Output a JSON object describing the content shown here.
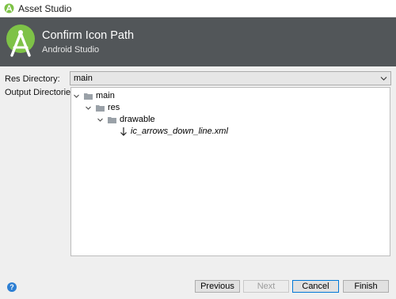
{
  "window": {
    "title": "Asset Studio"
  },
  "header": {
    "title": "Confirm Icon Path",
    "subtitle": "Android Studio"
  },
  "form": {
    "res_directory_label": "Res Directory:",
    "res_directory_value": "main",
    "output_directories_label": "Output Directories:"
  },
  "tree": {
    "main": "main",
    "res": "res",
    "drawable": "drawable",
    "file": "ic_arrows_down_line.xml"
  },
  "buttons": {
    "help": "?",
    "previous": "Previous",
    "next": "Next",
    "cancel": "Cancel",
    "finish": "Finish"
  },
  "colors": {
    "header_bg": "#525659",
    "android_green": "#7ec247",
    "accent": "#0078d7"
  }
}
